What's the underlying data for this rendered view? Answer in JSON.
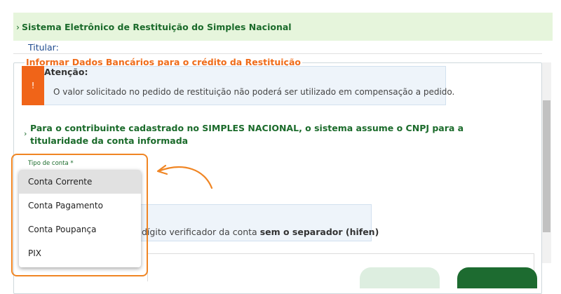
{
  "header": {
    "title": "Sistema Eletrônico de Restituição do Simples Nacional",
    "chevron": "›"
  },
  "titular": {
    "label": "Titular:"
  },
  "section": {
    "legend": "Informar Dados Bancários para o crédito da Restituição"
  },
  "alert": {
    "icon": "!",
    "title": "Atenção:",
    "text": "O valor solicitado no pedido de restituição não poderá ser utilizado em compensação a pedido."
  },
  "info": {
    "chevron": "›",
    "text": "Para o contribuinte cadastrado no SIMPLES NACIONAL, o sistema assume o CNPJ para a titularidade da conta informada"
  },
  "account_type": {
    "label": "Tipo de conta *",
    "selected": "Conta Corrente",
    "options": [
      "Conta Corrente",
      "Conta Pagamento",
      "Conta Poupança",
      "PIX"
    ]
  },
  "hint": {
    "text_prefix": "dígito verificador da conta ",
    "text_bold": "sem o separador (hifen)"
  },
  "colors": {
    "header_bg": "#e6f5dc",
    "header_text": "#1b6b2b",
    "legend": "#ef6c1a",
    "alert_icon": "#f06418",
    "annotation": "#f08523",
    "primary_button": "#1d6b30"
  }
}
